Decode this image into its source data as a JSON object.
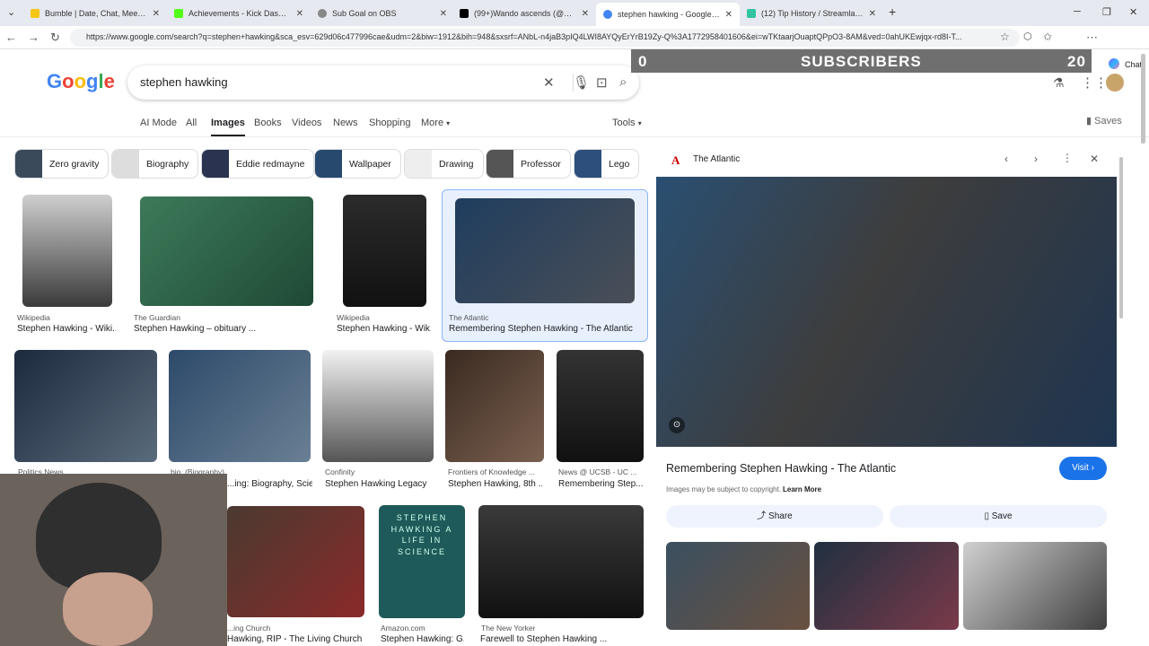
{
  "tabs": [
    {
      "label": "Bumble | Date, Chat, Meet New Pe",
      "color": "#f5c518"
    },
    {
      "label": "Achievements - Kick Dashboard",
      "color": "#53fc18"
    },
    {
      "label": "Sub Goal on OBS",
      "color": "#888888"
    },
    {
      "label": "(99+)Wando ascends (@wandoas",
      "color": "#000000"
    },
    {
      "label": "stephen hawking - Google Search",
      "color": "#4285f4"
    },
    {
      "label": "(12) Tip History / Streamlabs",
      "color": "#31c3a2"
    }
  ],
  "url": "https://www.google.com/search?q=stephen+hawking&sca_esv=629d06c477996cae&udm=2&biw=1912&bih=948&sxsrf=ANbL-n4jaB3pIQ4LWI8AYQyErYrB19Zy-Q%3A1772958401606&ei=wTKtaarjOuaptQPpO3-8AM&ved=0ahUKEwjqx-rd8I-T...",
  "chat_label": "Chat",
  "logo_text": "Google",
  "search_query": "stephen hawking",
  "overlay": {
    "left": "0",
    "label": "SUBSCRIBERS",
    "right": "20"
  },
  "nav_tabs": [
    "AI Mode",
    "All",
    "Images",
    "Books",
    "Videos",
    "News",
    "Shopping",
    "More",
    "Tools"
  ],
  "saves_label": "Saves",
  "chips": [
    "Zero gravity",
    "Biography",
    "Eddie redmayne",
    "Wallpaper",
    "Drawing",
    "Professor",
    "Lego"
  ],
  "results": [
    {
      "source": "Wikipedia",
      "title": "Stephen Hawking - Wiki..."
    },
    {
      "source": "The Guardian",
      "title": "Stephen Hawking – obituary ..."
    },
    {
      "source": "Wikipedia",
      "title": "Stephen Hawking - Wik..."
    },
    {
      "source": "The Atlantic",
      "title": "Remembering Stephen Hawking - The Atlantic"
    },
    {
      "source": "Politics News",
      "title": ""
    },
    {
      "source": "bio. (Biography)",
      "title": "...ing: Biography, Scie..."
    },
    {
      "source": "Confinity",
      "title": "Stephen Hawking Legacy"
    },
    {
      "source": "Frontiers of Knowledge ...",
      "title": "Stephen Hawking, 8th ..."
    },
    {
      "source": "News @ UCSB - UC ...",
      "title": "Remembering Step..."
    },
    {
      "source": "...ing Church",
      "title": "Hawking, RIP - The Living Church"
    },
    {
      "source": "Amazon.com",
      "title": "Stephen Hawking: G..."
    },
    {
      "source": "The New Yorker",
      "title": "Farewell to Stephen Hawking ..."
    }
  ],
  "book_cover_text": "STEPHEN HAWKING A LIFE IN SCIENCE",
  "panel": {
    "source": "The Atlantic",
    "source_initial": "A",
    "title": "Remembering Stephen Hawking - The Atlantic",
    "visit": "Visit",
    "copyright": "Images may be subject to copyright.",
    "learn_more": "Learn More",
    "share": "Share",
    "save": "Save"
  }
}
